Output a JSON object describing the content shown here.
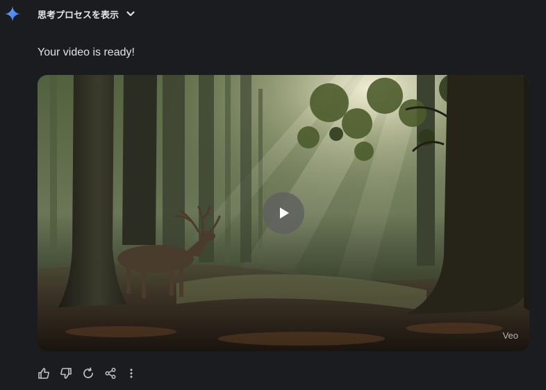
{
  "header": {
    "thoughts_toggle_label": "思考プロセスを表示",
    "logo_icon": "gemini-sparkle-icon",
    "toggle_icon": "chevron-down-icon"
  },
  "response": {
    "message": "Your video is ready!"
  },
  "video": {
    "watermark": "Veo",
    "play_icon": "play-icon"
  },
  "actions": {
    "icons": [
      "thumbs-up-icon",
      "thumbs-down-icon",
      "regenerate-icon",
      "share-icon",
      "more-vert-icon"
    ]
  },
  "colors": {
    "background": "#1b1c1f",
    "text": "#e3e3e3",
    "icon": "#c4c7c5",
    "gemini_blue": "#4c8df6"
  }
}
